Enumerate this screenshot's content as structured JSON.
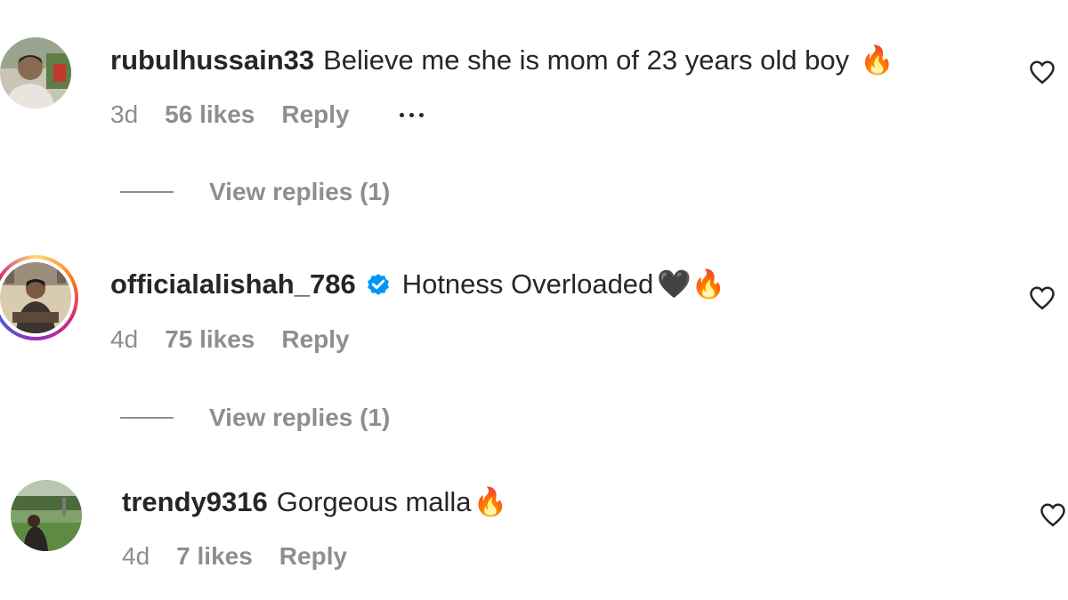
{
  "comments": [
    {
      "username": "rubulhussain33",
      "text": "Believe me she is mom of 23 years old boy",
      "emoji": "🔥",
      "time": "3d",
      "likes": "56 likes",
      "reply_label": "Reply",
      "verified": false,
      "view_replies": "View replies (1)"
    },
    {
      "username": "officialalishah_786",
      "text": "Hotness Overloaded",
      "emoji": "🖤🔥",
      "time": "4d",
      "likes": "75 likes",
      "reply_label": "Reply",
      "verified": true,
      "view_replies": "View replies (1)"
    },
    {
      "username": "trendy9316",
      "text": "Gorgeous malla",
      "emoji": "🔥",
      "time": "4d",
      "likes": "7 likes",
      "reply_label": "Reply",
      "verified": false
    }
  ],
  "colors": {
    "text_primary": "#262626",
    "text_secondary": "#8e8e8e",
    "verified_blue": "#0095f6"
  },
  "icons": {
    "like": "heart-outline-icon",
    "more": "more-options-icon",
    "verified": "verified-badge-icon"
  }
}
